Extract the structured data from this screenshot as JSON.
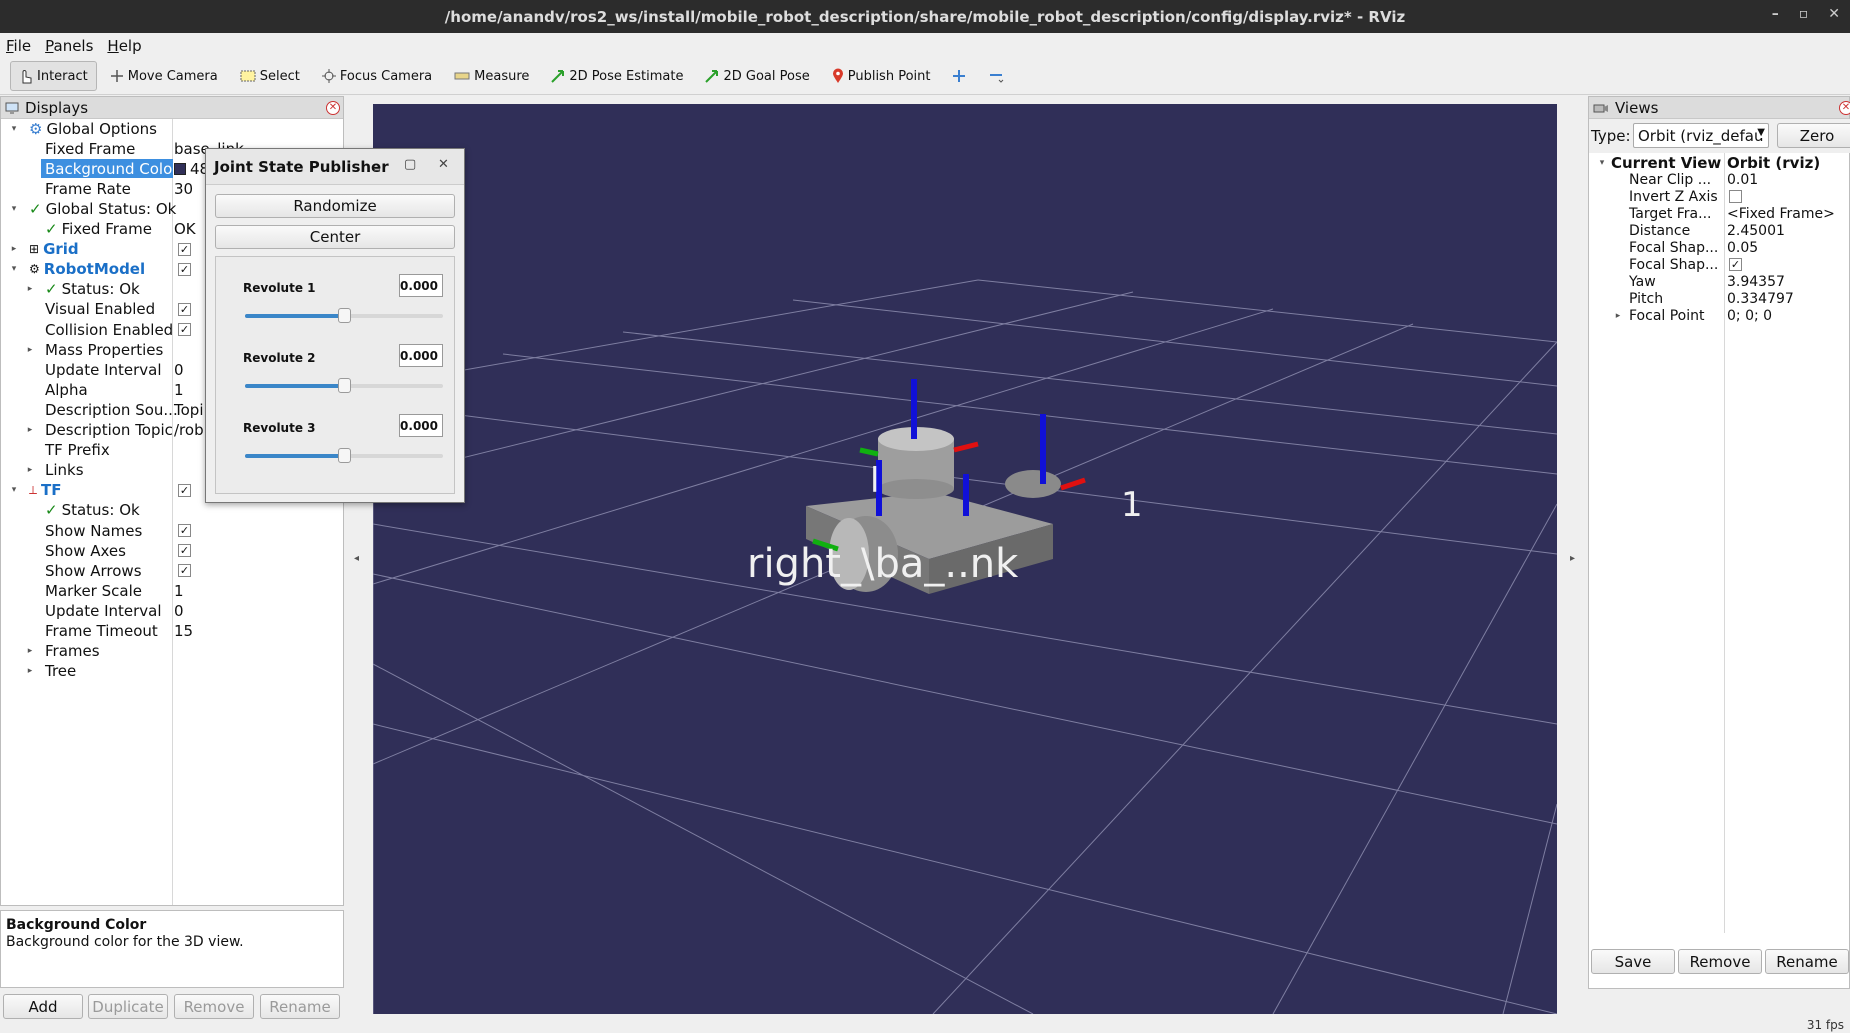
{
  "window": {
    "title": "/home/anandv/ros2_ws/install/mobile_robot_description/share/mobile_robot_description/config/display.rviz* - RViz"
  },
  "menu": [
    "File",
    "Panels",
    "Help"
  ],
  "toolbar": [
    "Interact",
    "Move Camera",
    "Select",
    "Focus Camera",
    "Measure",
    "2D Pose Estimate",
    "2D Goal Pose",
    "Publish Point"
  ],
  "displays": {
    "title": "Displays",
    "rows": [
      {
        "label": "Global Options",
        "value": ""
      },
      {
        "label": "Fixed Frame",
        "value": "base_link"
      },
      {
        "label": "Background Color",
        "value": "48"
      },
      {
        "label": "Frame Rate",
        "value": "30"
      },
      {
        "label": "Global Status: Ok",
        "value": ""
      },
      {
        "label": "Fixed Frame",
        "value": "OK"
      },
      {
        "label": "Grid",
        "value": ""
      },
      {
        "label": "RobotModel",
        "value": ""
      },
      {
        "label": "Status: Ok",
        "value": ""
      },
      {
        "label": "Visual Enabled",
        "value": ""
      },
      {
        "label": "Collision Enabled",
        "value": ""
      },
      {
        "label": "Mass Properties",
        "value": ""
      },
      {
        "label": "Update Interval",
        "value": "0"
      },
      {
        "label": "Alpha",
        "value": "1"
      },
      {
        "label": "Description Sou...",
        "value": "Topi"
      },
      {
        "label": "Description Topic",
        "value": "/rob"
      },
      {
        "label": "TF Prefix",
        "value": ""
      },
      {
        "label": "Links",
        "value": ""
      },
      {
        "label": "TF",
        "value": ""
      },
      {
        "label": "Status: Ok",
        "value": ""
      },
      {
        "label": "Show Names",
        "value": ""
      },
      {
        "label": "Show Axes",
        "value": ""
      },
      {
        "label": "Show Arrows",
        "value": ""
      },
      {
        "label": "Marker Scale",
        "value": "1"
      },
      {
        "label": "Update Interval",
        "value": "0"
      },
      {
        "label": "Frame Timeout",
        "value": "15"
      },
      {
        "label": "Frames",
        "value": ""
      },
      {
        "label": "Tree",
        "value": ""
      }
    ],
    "desc_title": "Background Color",
    "desc_text": "Background color for the 3D view.",
    "buttons": [
      "Add",
      "Duplicate",
      "Remove",
      "Rename"
    ]
  },
  "jsp": {
    "title": "Joint State Publisher",
    "randomize": "Randomize",
    "center": "Center",
    "joints": [
      {
        "name": "Revolute 1",
        "value": "0.000",
        "level": 0.5
      },
      {
        "name": "Revolute 2",
        "value": "0.000",
        "level": 0.5
      },
      {
        "name": "Revolute 3",
        "value": "0.000",
        "level": 0.5
      }
    ]
  },
  "viewport": {
    "label_main": "right_\\ba_..nk",
    "label_side": "1",
    "label_top": "l"
  },
  "views": {
    "title": "Views",
    "type_label": "Type:",
    "type_value": "Orbit (rviz_defau",
    "zero": "Zero",
    "header": {
      "label": "Current View",
      "value": "Orbit (rviz)"
    },
    "rows": [
      {
        "label": "Near Clip ...",
        "value": "0.01"
      },
      {
        "label": "Invert Z Axis",
        "value": ""
      },
      {
        "label": "Target Fra...",
        "value": "<Fixed Frame>"
      },
      {
        "label": "Distance",
        "value": "2.45001"
      },
      {
        "label": "Focal Shap...",
        "value": "0.05"
      },
      {
        "label": "Focal Shap...",
        "value": ""
      },
      {
        "label": "Yaw",
        "value": "3.94357"
      },
      {
        "label": "Pitch",
        "value": "0.334797"
      },
      {
        "label": "Focal Point",
        "value": "0; 0; 0"
      }
    ],
    "buttons": [
      "Save",
      "Remove",
      "Rename"
    ]
  },
  "status": {
    "fps": "31 fps"
  }
}
